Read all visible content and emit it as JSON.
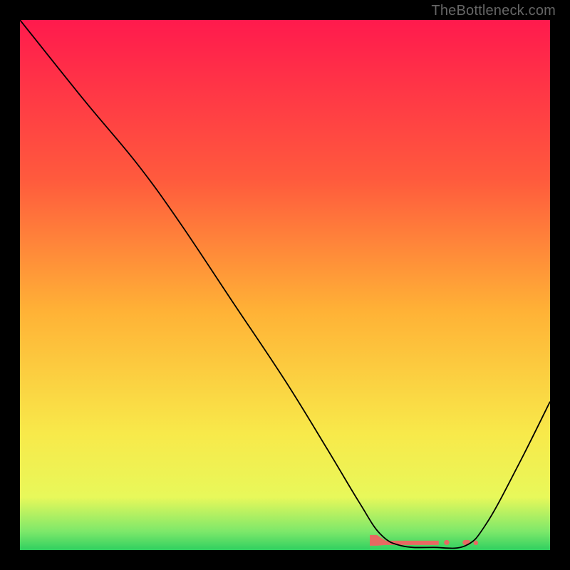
{
  "watermark": "TheBottleneck.com",
  "chart_data": {
    "type": "line",
    "title": "",
    "xlabel": "",
    "ylabel": "",
    "xlim": [
      0,
      100
    ],
    "ylim": [
      0,
      100
    ],
    "background": {
      "type": "vertical-gradient",
      "stops": [
        {
          "offset": 0,
          "color": "#ff1a4d"
        },
        {
          "offset": 0.3,
          "color": "#ff5a3d"
        },
        {
          "offset": 0.55,
          "color": "#ffb236"
        },
        {
          "offset": 0.78,
          "color": "#f8e94a"
        },
        {
          "offset": 0.9,
          "color": "#e8f85a"
        },
        {
          "offset": 0.965,
          "color": "#7de86a"
        },
        {
          "offset": 1.0,
          "color": "#30d060"
        }
      ]
    },
    "series": [
      {
        "name": "bottleneck-curve",
        "color": "#000000",
        "width": 1.8,
        "points": [
          {
            "x": 0,
            "y": 100
          },
          {
            "x": 12,
            "y": 85
          },
          {
            "x": 22,
            "y": 73
          },
          {
            "x": 30,
            "y": 62
          },
          {
            "x": 40,
            "y": 47
          },
          {
            "x": 50,
            "y": 32
          },
          {
            "x": 58,
            "y": 19
          },
          {
            "x": 64,
            "y": 9
          },
          {
            "x": 68,
            "y": 3
          },
          {
            "x": 72,
            "y": 0.8
          },
          {
            "x": 78,
            "y": 0.5
          },
          {
            "x": 84,
            "y": 0.8
          },
          {
            "x": 88,
            "y": 5
          },
          {
            "x": 94,
            "y": 16
          },
          {
            "x": 100,
            "y": 28
          }
        ]
      }
    ],
    "annotations": {
      "bottom_band": {
        "color": "#e76a62",
        "segments": [
          {
            "x1": 66,
            "x2": 79,
            "y": 1.5
          },
          {
            "x1": 80,
            "x2": 81,
            "y": 1.5
          },
          {
            "x1": 83.5,
            "x2": 85,
            "y": 1.5
          }
        ]
      }
    }
  }
}
